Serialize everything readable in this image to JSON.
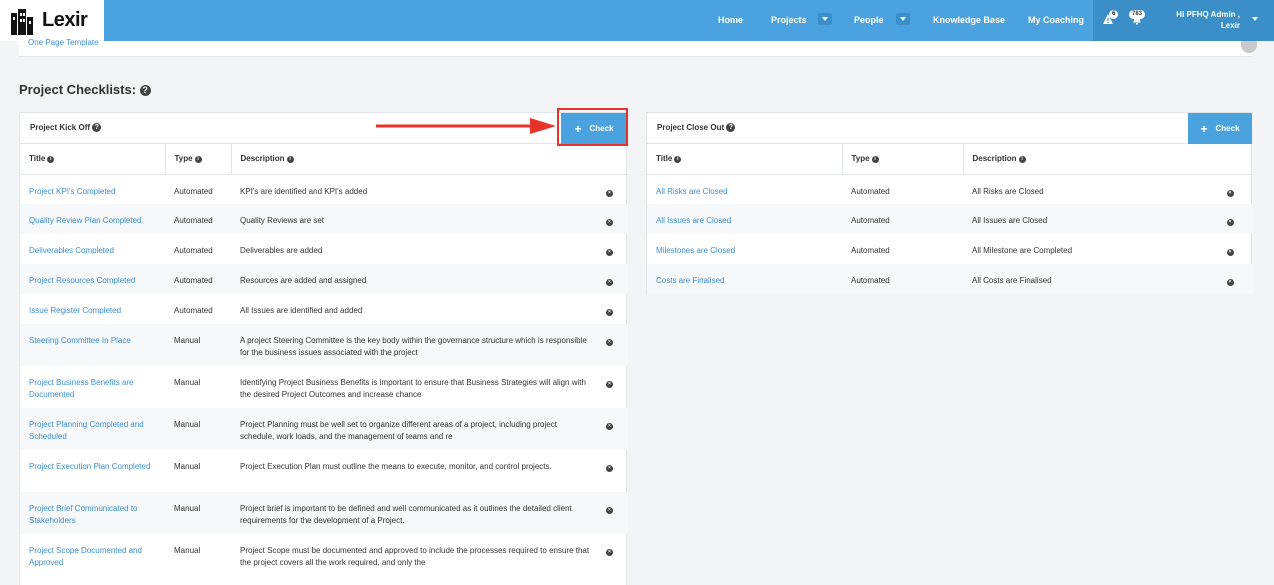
{
  "nav": {
    "logo": "Lexir",
    "items": [
      "Home",
      "Projects",
      "People",
      "Knowledge Base",
      "My Coaching"
    ],
    "alerts_count": "6",
    "messages_count": "783",
    "user_line1": "Hi PFHQ Admin ,",
    "user_line2": "Lexir"
  },
  "strip": {
    "link": "One Page Template"
  },
  "section_title": "Project Checklists:",
  "kickoff": {
    "title": "Project Kick Off",
    "check_label": "Check",
    "columns": [
      "Title",
      "Type",
      "Description"
    ],
    "rows": [
      {
        "title": "Project KPI's Completed",
        "type": "Automated",
        "desc": "KPI's are identified and KPI's added"
      },
      {
        "title": "Quality Review Plan Completed",
        "type": "Automated",
        "desc": "Quality Reviews are set"
      },
      {
        "title": "Deliverables Completed",
        "type": "Automated",
        "desc": "Deliverables are added"
      },
      {
        "title": "Project Resources Completed",
        "type": "Automated",
        "desc": "Resources are added and assigned"
      },
      {
        "title": "Issue Register Completed",
        "type": "Automated",
        "desc": "All Issues are identified and added"
      },
      {
        "title": "Steering Committee In Place",
        "type": "Manual",
        "desc": "A project Steering Committee is the key body within the governance structure which is responsible for the business issues associated with the project"
      },
      {
        "title": "Project Business Benefits are Documented",
        "type": "Manual",
        "desc": "Identifying Project Business Benefits is important to ensure that Business Strategies will align with the desired Project Outcomes and increase chance"
      },
      {
        "title": "Project Planning Completed and Scheduled",
        "type": "Manual",
        "desc": "Project Planning must be well set to organize different areas of a project, including project schedule, work loads, and the management of teams and re"
      },
      {
        "title": "Project Execution Plan Completed",
        "type": "Manual",
        "desc": "Project Execution Plan must outline the means to execute, monitor, and control projects."
      },
      {
        "title": "Project Brief Communicated to Stakeholders",
        "type": "Manual",
        "desc": "Project brief is important to be defined and well communicated as it outlines the detailed client requirements for the development of a Project."
      },
      {
        "title": "Project Scope Documented and Approved",
        "type": "Manual",
        "desc": "Project Scope must be documented and approved to include the processes required to ensure that the project covers all the work required, and only the"
      }
    ]
  },
  "closeout": {
    "title": "Project Close Out",
    "check_label": "Check",
    "columns": [
      "Title",
      "Type",
      "Description"
    ],
    "rows": [
      {
        "title": "All Risks are Closed",
        "type": "Automated",
        "desc": "All Risks are Closed"
      },
      {
        "title": "All Issues are Closed",
        "type": "Automated",
        "desc": "All Issues are Closed"
      },
      {
        "title": "Milestones are Closed",
        "type": "Automated",
        "desc": "All Milestone are Completed"
      },
      {
        "title": "Costs are Finalised",
        "type": "Automated",
        "desc": "All Costs are Finalised"
      }
    ]
  },
  "colors": {
    "nav": "#4aa3df",
    "link": "#3c8fd1",
    "highlight": "#e8332a"
  }
}
